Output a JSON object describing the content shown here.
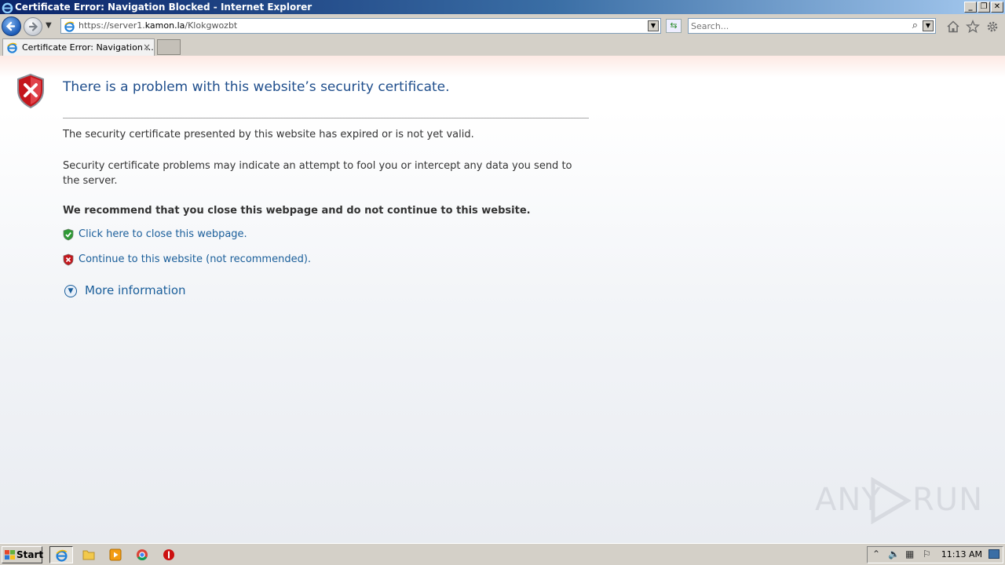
{
  "window": {
    "title": "Certificate Error: Navigation Blocked - Internet Explorer",
    "minimize": "_",
    "restore": "❐",
    "close": "✕"
  },
  "navbar": {
    "url_prefix": "https://server1.",
    "url_domain": "kamon.la",
    "url_path": "/Klokgwozbt",
    "search_placeholder": "Search...",
    "icons": [
      "back-arrow-icon",
      "forward-arrow-icon",
      "home-icon",
      "star-icon",
      "gear-icon"
    ]
  },
  "tabs": [
    {
      "label": "Certificate Error: Navigation ...",
      "close": "×"
    }
  ],
  "page": {
    "heading": "There is a problem with this website’s security certificate.",
    "para1": "The security certificate presented by this website has expired or is not yet valid.",
    "para2": "Security certificate problems may indicate an attempt to fool you or intercept any data you send to the server.",
    "recommend": "We recommend that you close this webpage and do not continue to this website.",
    "close_link": "Click here to close this webpage.",
    "continue_link": "Continue to this website (not recommended).",
    "more_info": "More information",
    "more_info_glyph": "▼"
  },
  "watermark": {
    "left": "ANY",
    "right": "RUN"
  },
  "taskbar": {
    "start_label": "Start",
    "apps": [
      "internet-explorer-icon",
      "folder-icon",
      "media-player-icon",
      "chrome-icon",
      "stop-icon"
    ],
    "clock": "11:13 AM"
  },
  "colors": {
    "heading": "#1f4e8c",
    "link": "#1a5e9a",
    "shield_red": "#c4161c",
    "shield_green": "#2e9a35"
  }
}
